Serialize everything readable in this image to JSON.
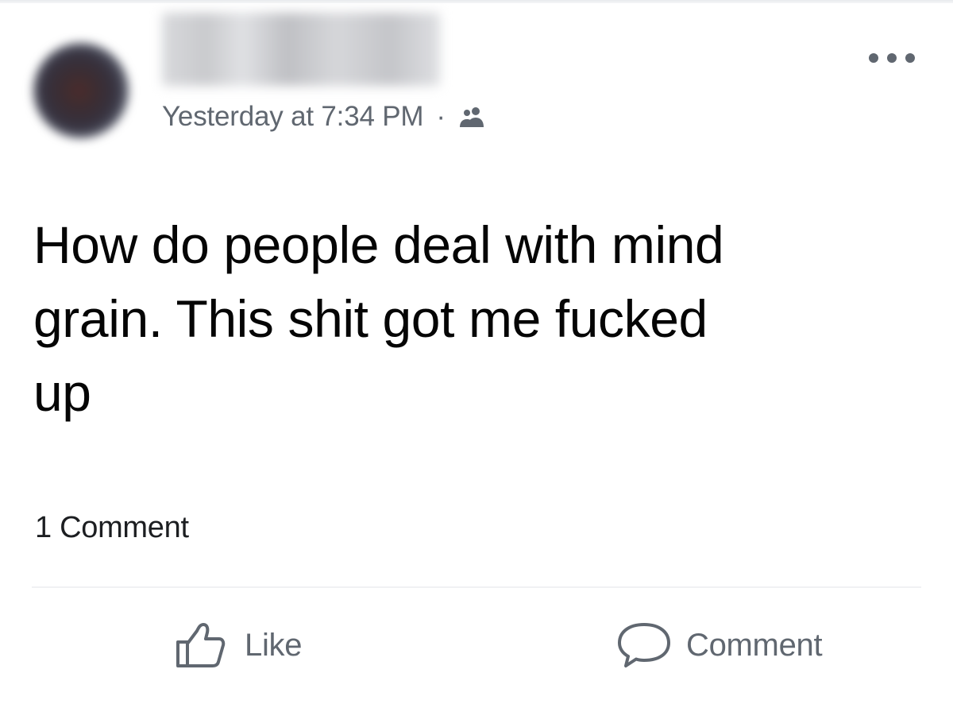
{
  "post": {
    "author": {
      "avatar_icon": "profile-photo-blurred",
      "name_redacted": true
    },
    "meta": {
      "timestamp": "Yesterday at 7:34 PM",
      "separator": "·",
      "audience_icon": "friends-icon"
    },
    "more_icon": "more-options-icon",
    "text": "How do people deal with mind\ngrain. This shit got me fucked\nup",
    "comments_count": "1 Comment",
    "actions": {
      "like_label": "Like",
      "like_icon": "thumbs-up-icon",
      "comment_label": "Comment",
      "comment_icon": "comment-bubble-icon"
    }
  },
  "colors": {
    "text_primary": "#050505",
    "text_secondary": "#606770",
    "divider": "#f0f1f3",
    "background": "#ffffff"
  }
}
